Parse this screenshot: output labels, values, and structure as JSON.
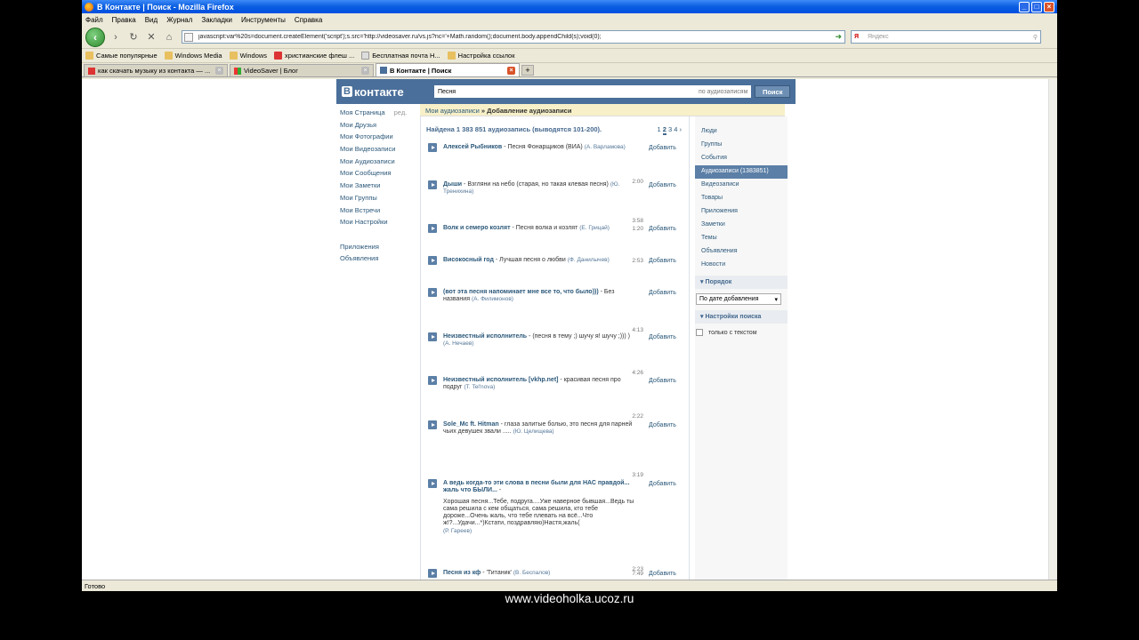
{
  "window": {
    "title": "В Контакте | Поиск - Mozilla Firefox"
  },
  "menu": [
    "Файл",
    "Правка",
    "Вид",
    "Журнал",
    "Закладки",
    "Инструменты",
    "Справка"
  ],
  "url": "javascript:var%20s=document.createElement('script');s.src='http://videosaver.ru/vs.js?nc='+Math.random();document.body.appendChild(s);void(0);",
  "search": {
    "placeholder": "Яндекс",
    "engine": "Я"
  },
  "bookmarks": [
    "Самые популярные",
    "Windows Media",
    "Windows",
    "христианские флеш ...",
    "Бесплатная почта H...",
    "Настройка ссылок"
  ],
  "tabs": [
    {
      "label": "как скачать музыку из контакта — ...",
      "active": false
    },
    {
      "label": "VideoSaver | Блог",
      "active": false
    },
    {
      "label": "В Контакте | Поиск",
      "active": true
    }
  ],
  "vk": {
    "logo": "контакте",
    "logo_b": "В",
    "query": "Песня",
    "search_in": "по аудиозаписям",
    "search_btn": "Поиск",
    "menu": [
      {
        "label": "Моя Страница",
        "extra": "ред."
      },
      {
        "label": "Мои Друзья"
      },
      {
        "label": "Мои Фотографии"
      },
      {
        "label": "Мои Видеозаписи"
      },
      {
        "label": "Мои Аудиозаписи"
      },
      {
        "label": "Мои Сообщения"
      },
      {
        "label": "Мои Заметки"
      },
      {
        "label": "Мои Группы"
      },
      {
        "label": "Мои Встречи"
      },
      {
        "label": "Мои Настройки"
      },
      {
        "label": ""
      },
      {
        "label": "Приложения"
      },
      {
        "label": "Объявления"
      }
    ],
    "crumb_link": "Мои аудиозаписи",
    "crumb_sep": " » ",
    "crumb_current": "Добавление аудиозаписи",
    "found": "Найдена 1 383 851 аудиозапись (выводятся 101-200).",
    "pages": [
      "1",
      "2",
      "3",
      "4",
      "›"
    ],
    "add_label": "Добавить",
    "results": [
      {
        "artist": "Алексей Рыбников",
        "title": " - Песня Фонарщиков (ВИА)",
        "author": " (А. Варламова)",
        "duration": "2:00",
        "extra": ""
      },
      {
        "artist": "Дыши",
        "title": " - Взгляни на небо (старая, но такая клевая песня)",
        "author": "(Ю. Тренихина)",
        "duration": "3:58",
        "extra": ""
      },
      {
        "artist": "Волк и семеро козлят",
        "title": " - Песня волка и козлят",
        "author": " (Е. Грицай)",
        "duration": "1:20",
        "extra": ""
      },
      {
        "artist": "Високосный год",
        "title": " - Лучшая песня о любви",
        "author": " (Ф. Данилычев)",
        "duration": "2:53",
        "extra": ""
      },
      {
        "artist": "(вот эта песня напоминает мне все то, что было)))",
        "title": " - Без названия",
        "author": " (А. Филимонов)",
        "duration": "4:13",
        "extra": ""
      },
      {
        "artist": "Неизвестный исполнитель",
        "title": " - (песня в тему ;) шучу я! шучу ;))) )",
        "author": "(А. Нечаев)",
        "duration": "4:26",
        "extra": ""
      },
      {
        "artist": "Неизвестный исполнитель [vkhp.net]",
        "title": " - красивая песня про подруг",
        "author": " (Т. Tel'nova)",
        "duration": "2:22",
        "extra": ""
      },
      {
        "artist": "Sole_Mc ft. Hitman",
        "title": " - глаза залитые болью, это песня для парней чьих девушек звали .....",
        "author": "(Ю. Целищева)",
        "duration": "3:19",
        "extra": ""
      },
      {
        "artist": "А ведь когда-то эти слова в песни были для НАС правдой... жаль что БЫЛИ...",
        "title": " -",
        "author": "(Р. Гареев)",
        "duration": "2:23",
        "extra": "Хорошая песня...Тебе, подруга....Уже наверное бывшая...Ведь ты сама решила с кем общаться, сама решила, кто тебе дороже...Очень жаль, что тебе плевать на всё...Что ж!?...Удачи...*)Кстати, поздравляю)Настя,жаль("
      },
      {
        "artist": "Песня из кф",
        "title": " - 'Титаник'",
        "author": " (В. Беспалов)",
        "duration": "7:49",
        "extra": ""
      }
    ],
    "right_nav": [
      "Люди",
      "Группы",
      "События",
      "Аудиозаписи (1383851)",
      "Видеозаписи",
      "Товары",
      "Приложения",
      "Заметки",
      "Темы",
      "Объявления",
      "Новости"
    ],
    "right_nav_selected": 3,
    "order_header": "▾ Порядок",
    "order_value": "По дате добавления",
    "settings_header": "▾ Настройки поиска",
    "only_text": "только с текстом"
  },
  "status": "Готово",
  "watermark": "www.videoholka.ucoz.ru",
  "colors": {
    "vk_blue": "#4a6f9a",
    "link": "#2b587a",
    "xp_title": "#0a5de0"
  }
}
